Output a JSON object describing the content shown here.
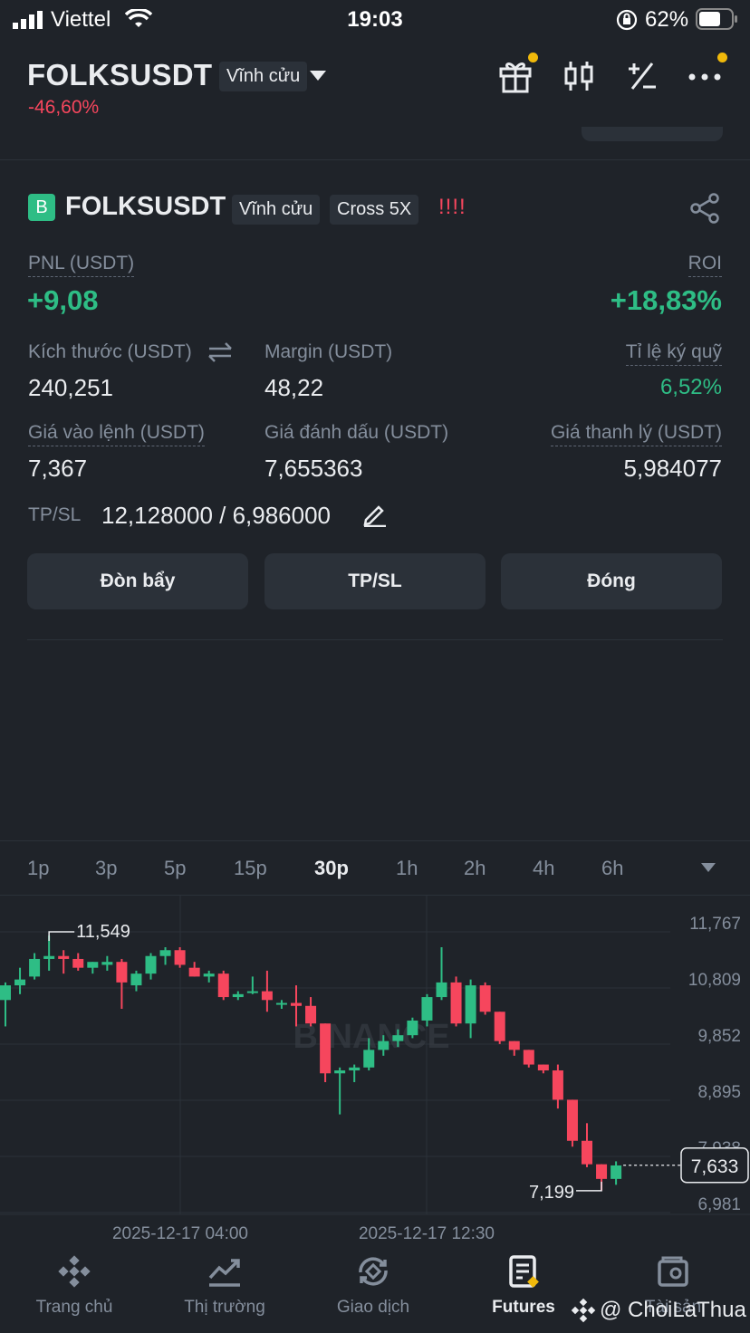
{
  "status_bar": {
    "carrier": "Viettel",
    "time": "19:03",
    "battery": "62%"
  },
  "header": {
    "symbol": "FOLKSUSDT",
    "contract_type": "Vĩnh cửu",
    "change": "-46,60%"
  },
  "position": {
    "badge": "B",
    "symbol": "FOLKSUSDT",
    "contract_type": "Vĩnh cửu",
    "margin_mode": "Cross 5X",
    "risk": "!!!!",
    "pnl_label": "PNL (USDT)",
    "pnl_value": "+9,08",
    "roi_label": "ROI",
    "roi_value": "+18,83%",
    "size_label": "Kích thước (USDT)",
    "size_value": "240,251",
    "margin_label": "Margin (USDT)",
    "margin_value": "48,22",
    "margin_ratio_label": "Tỉ lệ ký quỹ",
    "margin_ratio_value": "6,52%",
    "entry_label": "Giá vào lệnh (USDT)",
    "entry_value": "7,367",
    "mark_label": "Giá đánh dấu (USDT)",
    "mark_value": "7,655363",
    "liq_label": "Giá thanh lý (USDT)",
    "liq_value": "5,984077",
    "tpsl_label": "TP/SL",
    "tpsl_value": "12,128000 / 6,986000",
    "buttons": {
      "leverage": "Đòn bẩy",
      "tpsl": "TP/SL",
      "close": "Đóng"
    }
  },
  "timeframes": [
    "1p",
    "3p",
    "5p",
    "15p",
    "30p",
    "1h",
    "2h",
    "4h",
    "6h"
  ],
  "active_timeframe": "30p",
  "chart": {
    "watermark": "BINANCE",
    "y_labels": [
      "11,767",
      "10,809",
      "9,852",
      "8,895",
      "7,938",
      "6,981"
    ],
    "x_labels": [
      "2025-12-17 04:00",
      "2025-12-17 12:30"
    ],
    "high_label": "11,549",
    "low_label": "7,199",
    "current_price": "7,633",
    "colors": {
      "up": "#2ebd85",
      "down": "#f6465d"
    }
  },
  "chart_data": {
    "type": "candlestick",
    "ylim": [
      6.981,
      11.767
    ],
    "current_price": 7.633,
    "candles": [
      {
        "o": 10.45,
        "h": 10.75,
        "l": 10.0,
        "c": 10.7
      },
      {
        "o": 10.7,
        "h": 11.0,
        "l": 10.55,
        "c": 10.8
      },
      {
        "o": 10.85,
        "h": 11.25,
        "l": 10.8,
        "c": 11.15
      },
      {
        "o": 11.15,
        "h": 11.55,
        "l": 10.95,
        "c": 11.2
      },
      {
        "o": 11.2,
        "h": 11.3,
        "l": 10.9,
        "c": 11.15
      },
      {
        "o": 11.15,
        "h": 11.25,
        "l": 10.95,
        "c": 11.0
      },
      {
        "o": 11.0,
        "h": 11.1,
        "l": 10.9,
        "c": 11.1
      },
      {
        "o": 11.05,
        "h": 11.2,
        "l": 10.95,
        "c": 11.1
      },
      {
        "o": 11.1,
        "h": 11.15,
        "l": 10.3,
        "c": 10.75
      },
      {
        "o": 10.7,
        "h": 10.95,
        "l": 10.6,
        "c": 10.9
      },
      {
        "o": 10.9,
        "h": 11.25,
        "l": 10.8,
        "c": 11.2
      },
      {
        "o": 11.2,
        "h": 11.35,
        "l": 11.05,
        "c": 11.3
      },
      {
        "o": 11.3,
        "h": 11.35,
        "l": 11.0,
        "c": 11.05
      },
      {
        "o": 11.0,
        "h": 11.1,
        "l": 10.85,
        "c": 10.85
      },
      {
        "o": 10.85,
        "h": 10.95,
        "l": 10.75,
        "c": 10.9
      },
      {
        "o": 10.9,
        "h": 10.95,
        "l": 10.45,
        "c": 10.5
      },
      {
        "o": 10.5,
        "h": 10.6,
        "l": 10.45,
        "c": 10.55
      },
      {
        "o": 10.6,
        "h": 10.85,
        "l": 10.55,
        "c": 10.6
      },
      {
        "o": 10.6,
        "h": 10.95,
        "l": 10.25,
        "c": 10.45
      },
      {
        "o": 10.4,
        "h": 10.45,
        "l": 10.3,
        "c": 10.4
      },
      {
        "o": 10.4,
        "h": 10.7,
        "l": 10.0,
        "c": 10.35
      },
      {
        "o": 10.35,
        "h": 10.5,
        "l": 10.0,
        "c": 10.05
      },
      {
        "o": 10.05,
        "h": 10.05,
        "l": 9.05,
        "c": 9.2
      },
      {
        "o": 9.2,
        "h": 9.3,
        "l": 8.5,
        "c": 9.25
      },
      {
        "o": 9.25,
        "h": 9.35,
        "l": 9.05,
        "c": 9.3
      },
      {
        "o": 9.3,
        "h": 9.8,
        "l": 9.25,
        "c": 9.6
      },
      {
        "o": 9.6,
        "h": 9.85,
        "l": 9.5,
        "c": 9.75
      },
      {
        "o": 9.75,
        "h": 9.95,
        "l": 9.65,
        "c": 9.85
      },
      {
        "o": 9.85,
        "h": 10.15,
        "l": 9.8,
        "c": 10.1
      },
      {
        "o": 10.1,
        "h": 10.55,
        "l": 10.0,
        "c": 10.5
      },
      {
        "o": 10.5,
        "h": 11.35,
        "l": 10.45,
        "c": 10.75
      },
      {
        "o": 10.75,
        "h": 10.85,
        "l": 10.0,
        "c": 10.05
      },
      {
        "o": 10.05,
        "h": 10.8,
        "l": 9.8,
        "c": 10.7
      },
      {
        "o": 10.7,
        "h": 10.75,
        "l": 10.2,
        "c": 10.25
      },
      {
        "o": 10.25,
        "h": 10.25,
        "l": 9.7,
        "c": 9.75
      },
      {
        "o": 9.75,
        "h": 9.75,
        "l": 9.5,
        "c": 9.6
      },
      {
        "o": 9.6,
        "h": 9.6,
        "l": 9.3,
        "c": 9.35
      },
      {
        "o": 9.35,
        "h": 9.35,
        "l": 9.2,
        "c": 9.25
      },
      {
        "o": 9.25,
        "h": 9.35,
        "l": 8.6,
        "c": 8.75
      },
      {
        "o": 8.75,
        "h": 8.75,
        "l": 7.95,
        "c": 8.05
      },
      {
        "o": 8.05,
        "h": 8.35,
        "l": 7.6,
        "c": 7.65
      },
      {
        "o": 7.65,
        "h": 7.65,
        "l": 7.2,
        "c": 7.4
      },
      {
        "o": 7.4,
        "h": 7.7,
        "l": 7.3,
        "c": 7.63
      }
    ]
  },
  "bottom_nav": [
    {
      "label": "Trang chủ",
      "icon": "binance-logo-icon"
    },
    {
      "label": "Thị trường",
      "icon": "market-chart-icon"
    },
    {
      "label": "Giao dịch",
      "icon": "trade-swap-icon"
    },
    {
      "label": "Futures",
      "icon": "futures-doc-icon"
    },
    {
      "label": "Tài sản",
      "icon": "wallet-icon"
    }
  ],
  "watermark_user": "@ ChoiLaThua"
}
